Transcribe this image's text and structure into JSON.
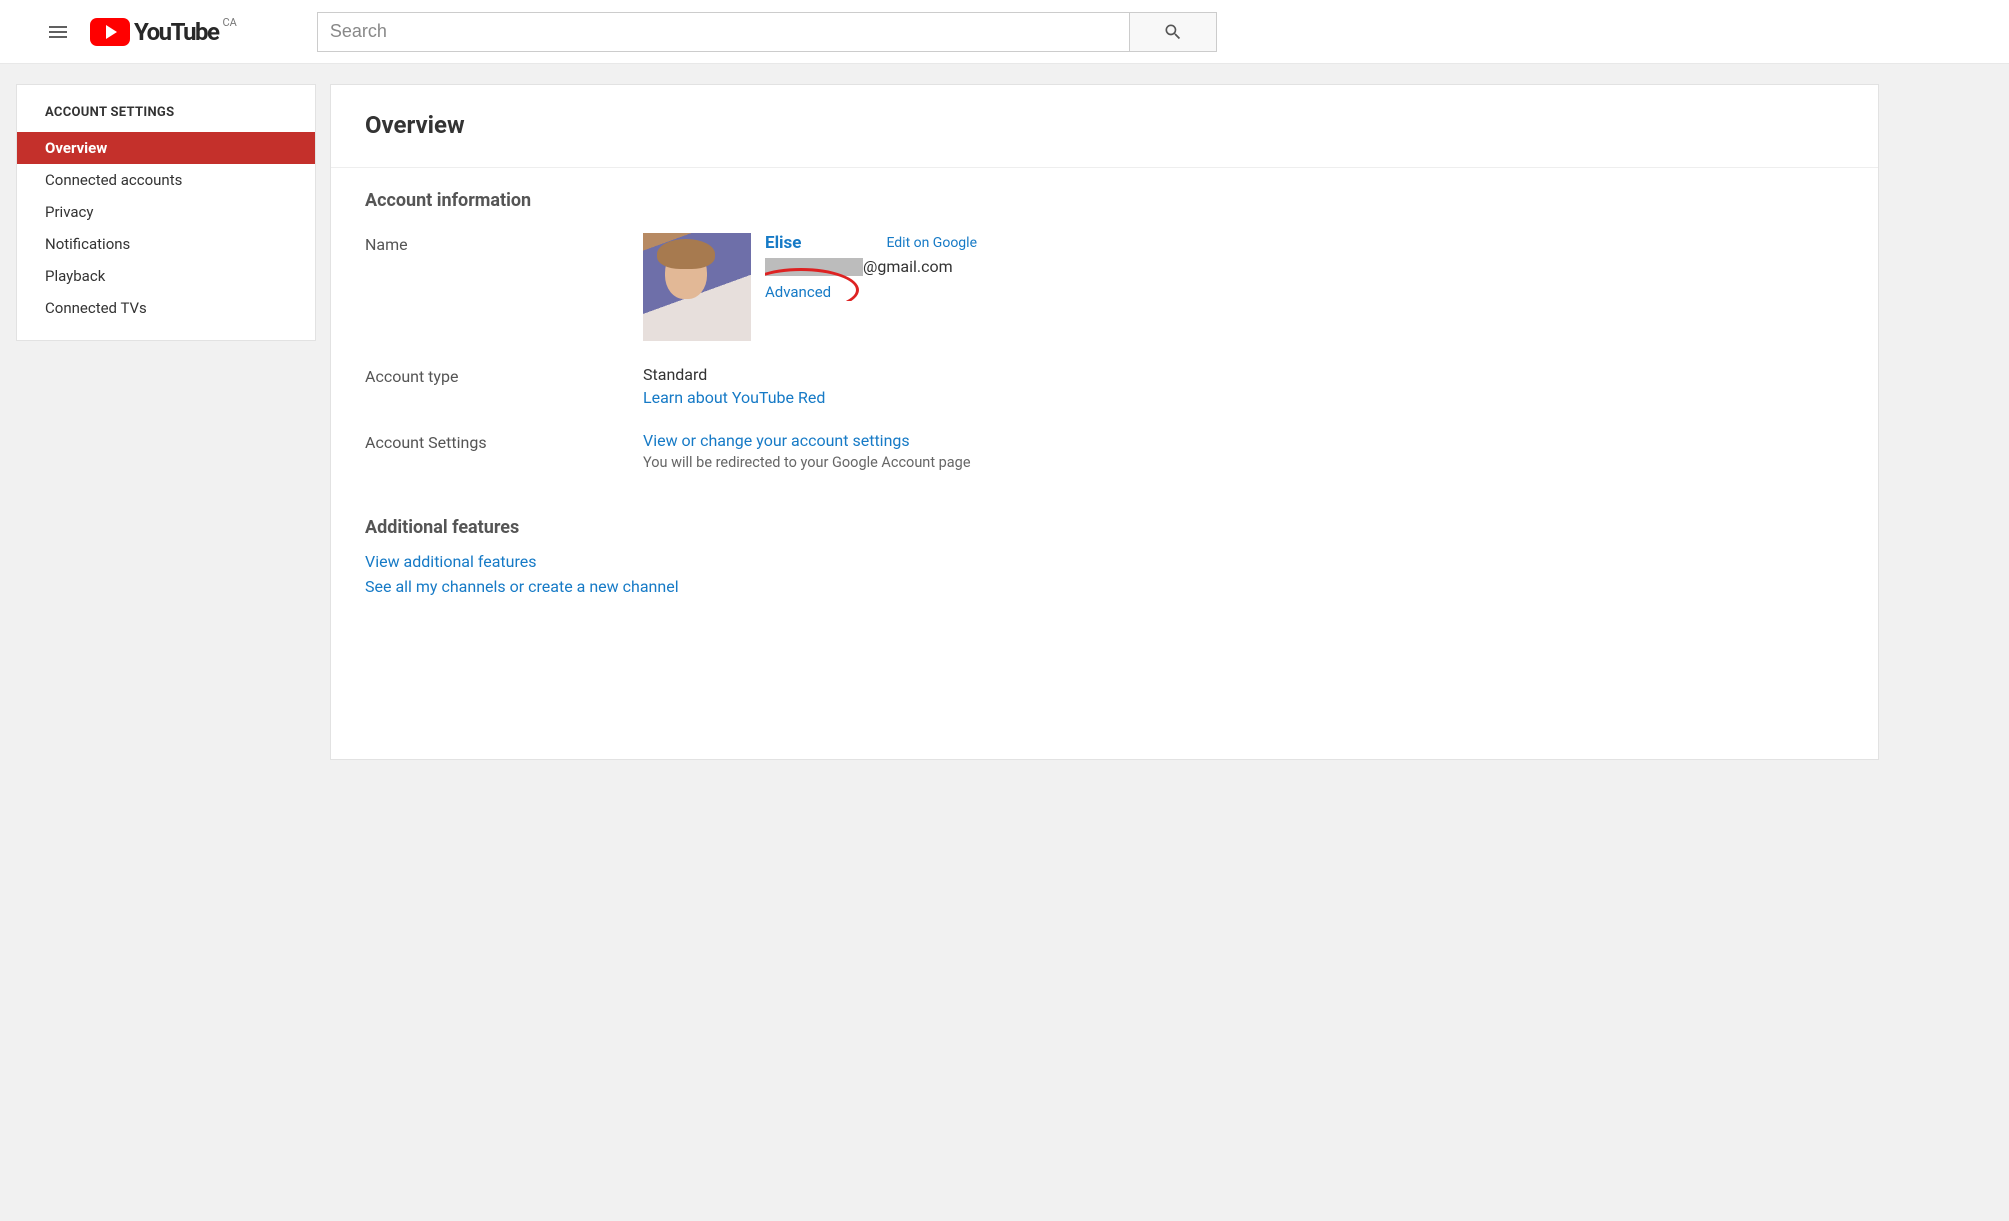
{
  "header": {
    "country": "CA",
    "logo_text": "YouTube",
    "search_placeholder": "Search"
  },
  "sidebar": {
    "title": "ACCOUNT SETTINGS",
    "items": [
      {
        "label": "Overview",
        "active": true
      },
      {
        "label": "Connected accounts",
        "active": false
      },
      {
        "label": "Privacy",
        "active": false
      },
      {
        "label": "Notifications",
        "active": false
      },
      {
        "label": "Playback",
        "active": false
      },
      {
        "label": "Connected TVs",
        "active": false
      }
    ]
  },
  "main": {
    "title": "Overview",
    "account_info": {
      "section_title": "Account information",
      "name_label": "Name",
      "name_value": "Elise",
      "edit_link": "Edit on Google",
      "email_domain": "@gmail.com",
      "advanced_link": "Advanced",
      "account_type_label": "Account type",
      "account_type_value": "Standard",
      "youtube_red_link": "Learn about YouTube Red",
      "settings_label": "Account Settings",
      "settings_link": "View or change your account settings",
      "settings_sub": "You will be redirected to your Google Account page"
    },
    "additional": {
      "section_title": "Additional features",
      "link1": "View additional features",
      "link2": "See all my channels or create a new channel"
    }
  }
}
